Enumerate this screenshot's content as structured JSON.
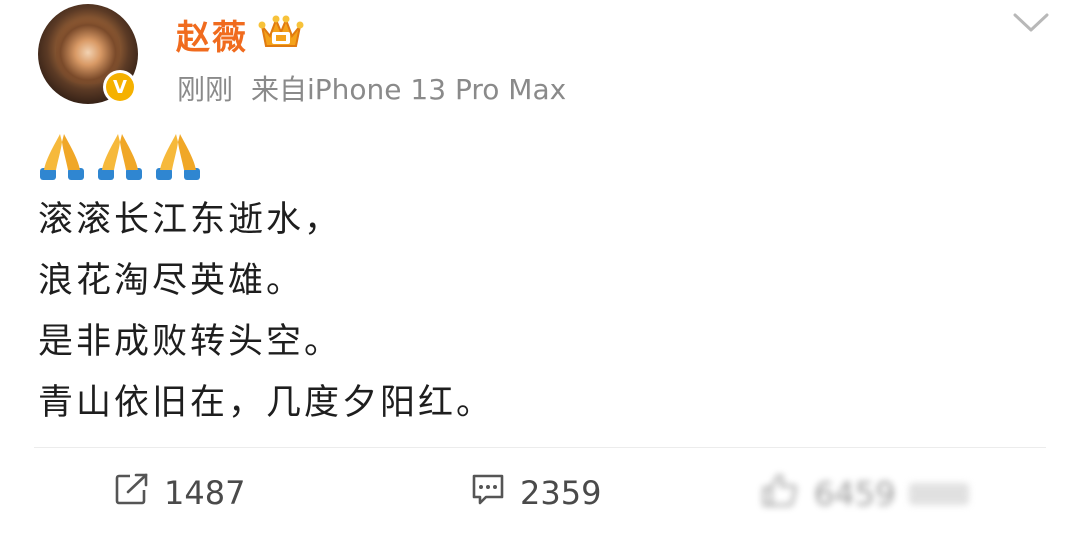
{
  "post": {
    "author": {
      "name": "赵薇"
    },
    "meta": {
      "time": "刚刚",
      "source": "来自iPhone 13 Pro Max"
    },
    "emojis": [
      "🙏",
      "🙏",
      "🙏"
    ],
    "lines": [
      "滚滚长江东逝水，",
      "浪花淘尽英雄。",
      "是非成败转头空。",
      "青山依旧在，几度夕阳红。"
    ],
    "actions": {
      "repost": {
        "icon": "share-icon",
        "count": "1487"
      },
      "comment": {
        "icon": "comment-icon",
        "count": "2359"
      },
      "like": {
        "icon": "thumbs-up-icon",
        "count": "6459"
      }
    }
  },
  "colors": {
    "author_name": "#f06b1e",
    "meta": "#8a8a8a",
    "verified_badge": "#f5b100",
    "background": "#ffffff"
  }
}
